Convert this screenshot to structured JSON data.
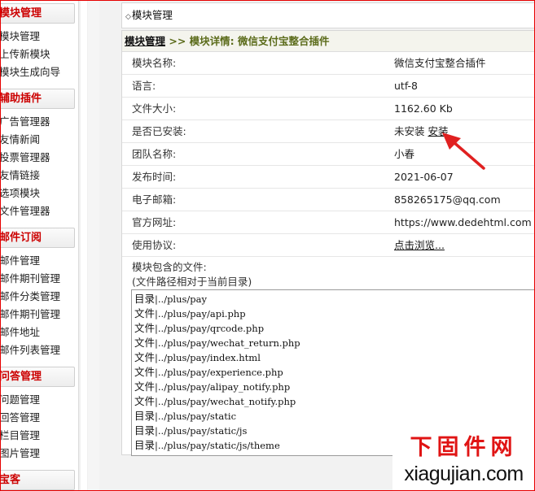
{
  "sidebar": {
    "sections": [
      {
        "title": "模块管理",
        "items": [
          "模块管理",
          "上传新模块",
          "模块生成向导"
        ]
      },
      {
        "title": "辅助插件",
        "items": [
          "广告管理器",
          "友情新闻",
          "投票管理器",
          "友情链接",
          "选项模块",
          "文件管理器"
        ]
      },
      {
        "title": "邮件订阅",
        "items": [
          "邮件管理",
          "邮件期刊管理",
          "邮件分类管理",
          "邮件期刊管理",
          "邮件地址",
          "邮件列表管理"
        ]
      },
      {
        "title": "问答管理",
        "items": [
          "问题管理",
          "回答管理",
          "栏目管理",
          "图片管理"
        ]
      },
      {
        "title": "宝客",
        "items": []
      }
    ]
  },
  "panel": {
    "title": "模块管理",
    "breadcrumb_root": "模块管理",
    "breadcrumb_rest": " >> 模块详情:  微信支付宝整合插件"
  },
  "details": [
    {
      "label": "模块名称:",
      "value": "微信支付宝整合插件"
    },
    {
      "label": "语言:",
      "value": "utf-8"
    },
    {
      "label": "文件大小:",
      "value": "1162.60 Kb"
    },
    {
      "label": "是否已安装:",
      "value": "未安装",
      "link": "安装"
    },
    {
      "label": "团队名称:",
      "value": "小春"
    },
    {
      "label": "发布时间:",
      "value": "2021-06-07"
    },
    {
      "label": "电子邮箱:",
      "value": "858265175@qq.com"
    },
    {
      "label": "官方网址:",
      "value": "https://www.dedehtml.com"
    },
    {
      "label": "使用协议:",
      "value": "",
      "link": "点击浏览..."
    }
  ],
  "files_label_line1": "模块包含的文件:",
  "files_label_line2": "(文件路径相对于当前目录)",
  "files": [
    {
      "kind": "目录",
      "path": "|../plus/pay"
    },
    {
      "kind": "文件",
      "path": "|../plus/pay/api.php"
    },
    {
      "kind": "文件",
      "path": "|../plus/pay/qrcode.php"
    },
    {
      "kind": "文件",
      "path": "|../plus/pay/wechat_return.php"
    },
    {
      "kind": "文件",
      "path": "|../plus/pay/index.html"
    },
    {
      "kind": "文件",
      "path": "|../plus/pay/experience.php"
    },
    {
      "kind": "文件",
      "path": "|../plus/pay/alipay_notify.php"
    },
    {
      "kind": "文件",
      "path": "|../plus/pay/wechat_notify.php"
    },
    {
      "kind": "目录",
      "path": "|../plus/pay/static"
    },
    {
      "kind": "目录",
      "path": "|../plus/pay/static/js"
    },
    {
      "kind": "目录",
      "path": "|../plus/pay/static/js/theme"
    }
  ],
  "watermark": {
    "top": "下固件网",
    "bottom": "xiagujian.com"
  },
  "colors": {
    "section_title": "#cc0000",
    "crumb_text": "#5b6b1a",
    "arrow": "#e02020",
    "frame": "#e60000"
  }
}
